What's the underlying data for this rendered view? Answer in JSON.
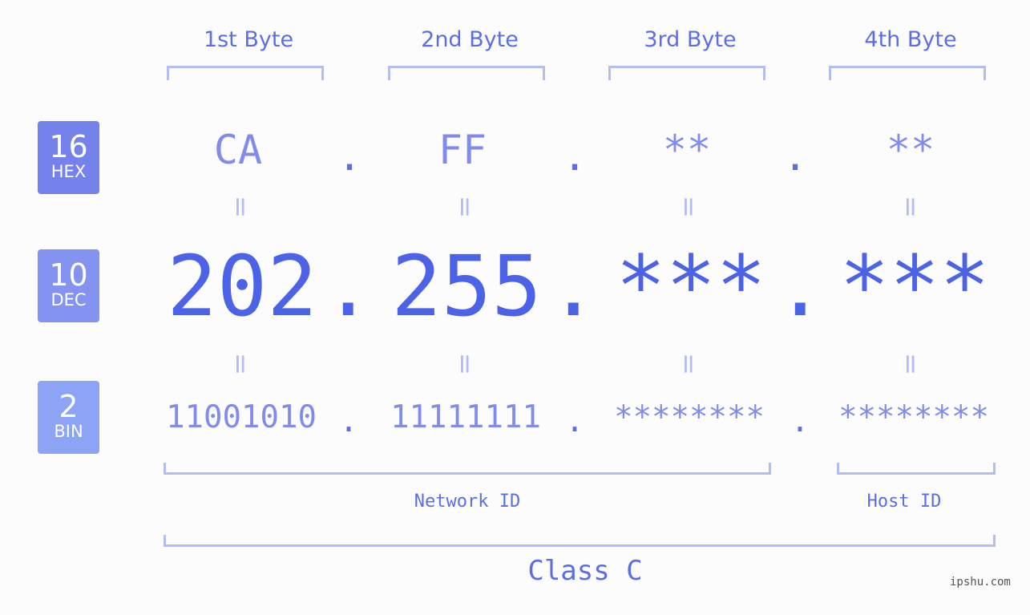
{
  "headers": [
    "1st Byte",
    "2nd Byte",
    "3rd Byte",
    "4th Byte"
  ],
  "badges": [
    {
      "num": "16",
      "label": "HEX",
      "color": "#7582ec"
    },
    {
      "num": "10",
      "label": "DEC",
      "color": "#8593f0"
    },
    {
      "num": "2",
      "label": "BIN",
      "color": "#8da3f5"
    }
  ],
  "hex": [
    "CA",
    "FF",
    "**",
    "**"
  ],
  "dec": [
    "202",
    "255",
    "***",
    "***"
  ],
  "bin": [
    "11001010",
    "11111111",
    "********",
    "********"
  ],
  "separator": ".",
  "equals": "=",
  "network_label": "Network ID",
  "host_label": "Host ID",
  "class_label": "Class C",
  "watermark": "ipshu.com",
  "colors": {
    "accent": "#4d63e7",
    "light": "#7f8ced",
    "bracket": "#b3bdf5"
  }
}
